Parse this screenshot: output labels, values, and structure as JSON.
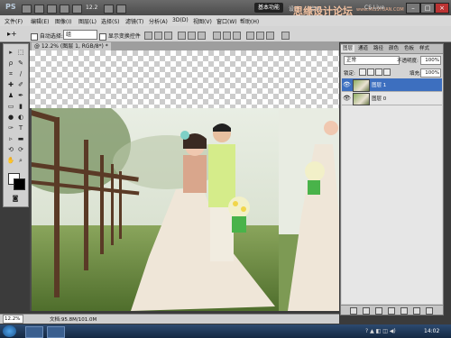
{
  "app": {
    "logo": "PS",
    "zoom_top": "12.2"
  },
  "workspace": {
    "active": "基本功能",
    "links": [
      "设计",
      "绘画"
    ],
    "cs_live": "CS Live"
  },
  "watermark": {
    "text": "思缘设计论坛",
    "url": "www.MISSYUAN.COM"
  },
  "menu": [
    "文件(F)",
    "编辑(E)",
    "图像(I)",
    "图层(L)",
    "选择(S)",
    "滤镜(T)",
    "分析(A)",
    "3D(D)",
    "视图(V)",
    "窗口(W)",
    "帮助(H)"
  ],
  "options": {
    "auto_select": "自动选择:",
    "auto_select_value": "组",
    "show_transform": "显示变换控件"
  },
  "document": {
    "tab_label": "@ 12.2% (图层 1, RGB/8*) *"
  },
  "status": {
    "zoom": "12.2%",
    "doc_info": "文档:95.8M/101.0M"
  },
  "layers_panel": {
    "tabs": [
      "图层",
      "通道",
      "路径",
      "颜色",
      "色板",
      "样式"
    ],
    "blend_mode": "正常",
    "opacity_label": "不透明度:",
    "opacity_value": "100%",
    "lock_label": "锁定:",
    "fill_label": "填充:",
    "fill_value": "100%",
    "layers": [
      {
        "name": "图层 1",
        "selected": true
      },
      {
        "name": "图层 0",
        "selected": false
      }
    ]
  },
  "taskbar": {
    "clock": "14:02"
  },
  "colors": {
    "selection": "#3d6fbf",
    "ui_gray": "#d4d4d4"
  }
}
